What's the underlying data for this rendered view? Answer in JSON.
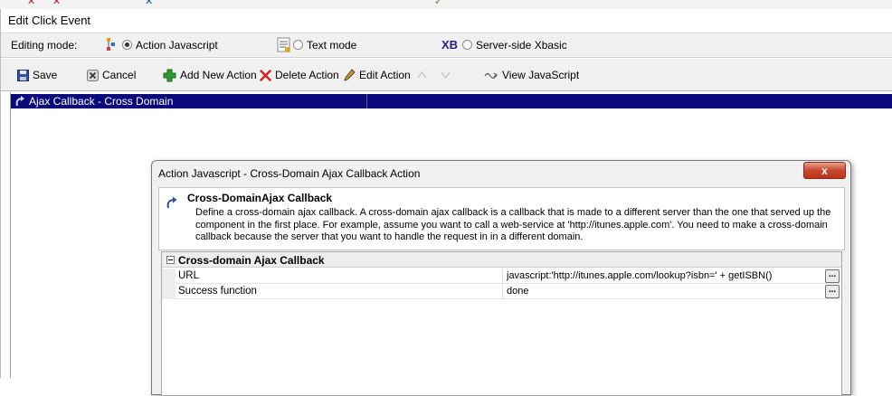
{
  "window": {
    "title": "Edit Click Event"
  },
  "editing_mode": {
    "label": "Editing mode:",
    "options": [
      {
        "label": "Action Javascript",
        "selected": true
      },
      {
        "label": "Text mode",
        "selected": false
      },
      {
        "label": "Server-side Xbasic",
        "selected": false
      }
    ],
    "xbasic_logo": "XB"
  },
  "toolbar": {
    "save": "Save",
    "cancel": "Cancel",
    "add_new_action": "Add New Action",
    "delete_action": "Delete Action",
    "edit_action": "Edit Action",
    "view_javascript": "View JavaScript"
  },
  "actions_list": {
    "items": [
      {
        "label": "Ajax Callback - Cross Domain",
        "selected": true
      }
    ]
  },
  "dialog": {
    "title": "Action Javascript - Cross-Domain Ajax Callback Action",
    "close_glyph": "x",
    "heading": "Cross-DomainAjax Callback",
    "description": "Define a cross-domain ajax callback. A cross-domain ajax callback is a callback that is made to a different server than the one that served up the component in the first place. For example, assume you want to call a web-service at 'http://itunes.apple.com'. You need to make a cross-domain callback because the server that you want to handle the request in in a different domain.",
    "category": "Cross-domain Ajax Callback",
    "properties": [
      {
        "name": "URL",
        "value": "javascript:'http://itunes.apple.com/lookup?isbn=' + getISBN()",
        "button": "..."
      },
      {
        "name": "Success function",
        "value": "done",
        "button": "..."
      }
    ]
  },
  "colors": {
    "selection": "#0a0a7a",
    "toolbar_bg": "#f0f0f0",
    "close_red": "#c8482e",
    "add_green": "#2e9a2e",
    "delete_red": "#d22020"
  }
}
